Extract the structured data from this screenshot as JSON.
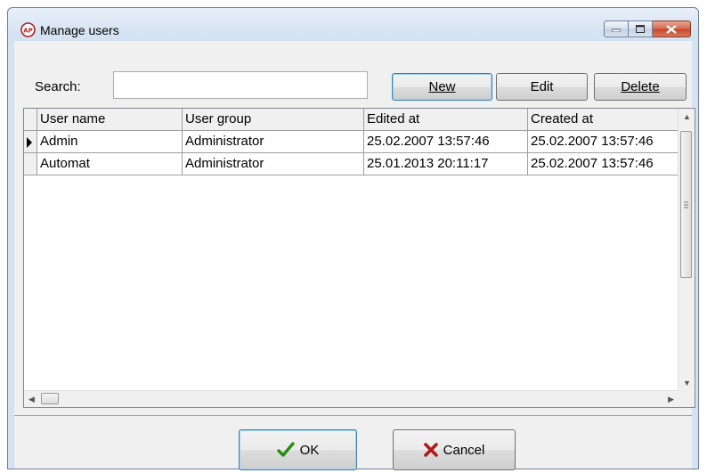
{
  "window": {
    "title": "Manage users"
  },
  "search": {
    "label": "Search:",
    "value": "",
    "placeholder": ""
  },
  "toolbar": {
    "new_label": "New",
    "edit_label": "Edit",
    "delete_label": "Delete"
  },
  "grid": {
    "columns": [
      "User name",
      "User group",
      "Edited at",
      "Created at"
    ],
    "rows": [
      [
        "Admin",
        "Administrator",
        "25.02.2007 13:57:46",
        "25.02.2007 13:57:46"
      ],
      [
        "Automat",
        "Administrator",
        "25.01.2013 20:11:17",
        "25.02.2007 13:57:46"
      ]
    ],
    "current_row": 0
  },
  "footer": {
    "ok_label": "OK",
    "cancel_label": "Cancel"
  },
  "colors": {
    "title_gradient": "#d5e2f1",
    "close_button": "#c7442a",
    "ok_check": "#2a8a12",
    "cancel_x": "#b01818"
  },
  "icons": [
    "app-icon",
    "minimize-icon",
    "maximize-icon",
    "close-icon",
    "checkmark-icon",
    "cancel-x-icon",
    "row-pointer-icon"
  ]
}
